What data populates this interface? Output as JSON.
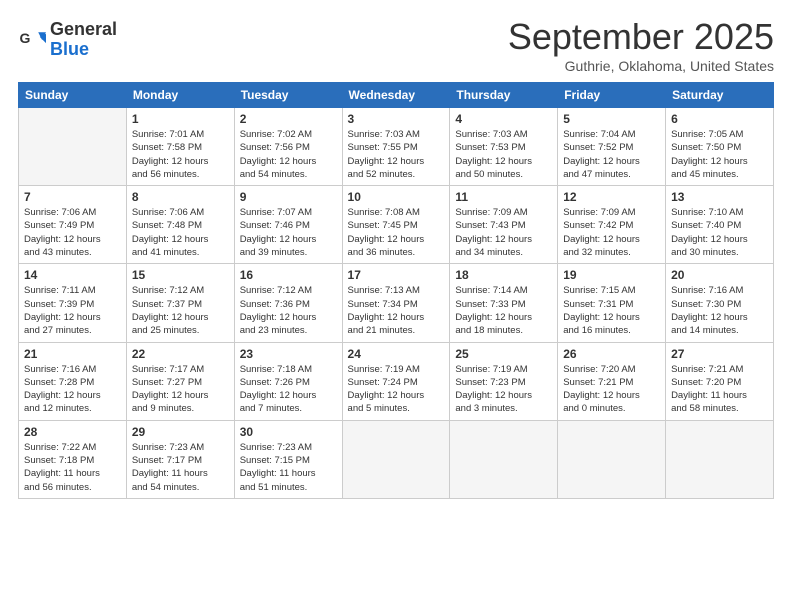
{
  "header": {
    "logo_line1": "General",
    "logo_line2": "Blue",
    "month": "September 2025",
    "location": "Guthrie, Oklahoma, United States"
  },
  "days_of_week": [
    "Sunday",
    "Monday",
    "Tuesday",
    "Wednesday",
    "Thursday",
    "Friday",
    "Saturday"
  ],
  "weeks": [
    [
      {
        "day": "",
        "info": ""
      },
      {
        "day": "1",
        "info": "Sunrise: 7:01 AM\nSunset: 7:58 PM\nDaylight: 12 hours\nand 56 minutes."
      },
      {
        "day": "2",
        "info": "Sunrise: 7:02 AM\nSunset: 7:56 PM\nDaylight: 12 hours\nand 54 minutes."
      },
      {
        "day": "3",
        "info": "Sunrise: 7:03 AM\nSunset: 7:55 PM\nDaylight: 12 hours\nand 52 minutes."
      },
      {
        "day": "4",
        "info": "Sunrise: 7:03 AM\nSunset: 7:53 PM\nDaylight: 12 hours\nand 50 minutes."
      },
      {
        "day": "5",
        "info": "Sunrise: 7:04 AM\nSunset: 7:52 PM\nDaylight: 12 hours\nand 47 minutes."
      },
      {
        "day": "6",
        "info": "Sunrise: 7:05 AM\nSunset: 7:50 PM\nDaylight: 12 hours\nand 45 minutes."
      }
    ],
    [
      {
        "day": "7",
        "info": "Sunrise: 7:06 AM\nSunset: 7:49 PM\nDaylight: 12 hours\nand 43 minutes."
      },
      {
        "day": "8",
        "info": "Sunrise: 7:06 AM\nSunset: 7:48 PM\nDaylight: 12 hours\nand 41 minutes."
      },
      {
        "day": "9",
        "info": "Sunrise: 7:07 AM\nSunset: 7:46 PM\nDaylight: 12 hours\nand 39 minutes."
      },
      {
        "day": "10",
        "info": "Sunrise: 7:08 AM\nSunset: 7:45 PM\nDaylight: 12 hours\nand 36 minutes."
      },
      {
        "day": "11",
        "info": "Sunrise: 7:09 AM\nSunset: 7:43 PM\nDaylight: 12 hours\nand 34 minutes."
      },
      {
        "day": "12",
        "info": "Sunrise: 7:09 AM\nSunset: 7:42 PM\nDaylight: 12 hours\nand 32 minutes."
      },
      {
        "day": "13",
        "info": "Sunrise: 7:10 AM\nSunset: 7:40 PM\nDaylight: 12 hours\nand 30 minutes."
      }
    ],
    [
      {
        "day": "14",
        "info": "Sunrise: 7:11 AM\nSunset: 7:39 PM\nDaylight: 12 hours\nand 27 minutes."
      },
      {
        "day": "15",
        "info": "Sunrise: 7:12 AM\nSunset: 7:37 PM\nDaylight: 12 hours\nand 25 minutes."
      },
      {
        "day": "16",
        "info": "Sunrise: 7:12 AM\nSunset: 7:36 PM\nDaylight: 12 hours\nand 23 minutes."
      },
      {
        "day": "17",
        "info": "Sunrise: 7:13 AM\nSunset: 7:34 PM\nDaylight: 12 hours\nand 21 minutes."
      },
      {
        "day": "18",
        "info": "Sunrise: 7:14 AM\nSunset: 7:33 PM\nDaylight: 12 hours\nand 18 minutes."
      },
      {
        "day": "19",
        "info": "Sunrise: 7:15 AM\nSunset: 7:31 PM\nDaylight: 12 hours\nand 16 minutes."
      },
      {
        "day": "20",
        "info": "Sunrise: 7:16 AM\nSunset: 7:30 PM\nDaylight: 12 hours\nand 14 minutes."
      }
    ],
    [
      {
        "day": "21",
        "info": "Sunrise: 7:16 AM\nSunset: 7:28 PM\nDaylight: 12 hours\nand 12 minutes."
      },
      {
        "day": "22",
        "info": "Sunrise: 7:17 AM\nSunset: 7:27 PM\nDaylight: 12 hours\nand 9 minutes."
      },
      {
        "day": "23",
        "info": "Sunrise: 7:18 AM\nSunset: 7:26 PM\nDaylight: 12 hours\nand 7 minutes."
      },
      {
        "day": "24",
        "info": "Sunrise: 7:19 AM\nSunset: 7:24 PM\nDaylight: 12 hours\nand 5 minutes."
      },
      {
        "day": "25",
        "info": "Sunrise: 7:19 AM\nSunset: 7:23 PM\nDaylight: 12 hours\nand 3 minutes."
      },
      {
        "day": "26",
        "info": "Sunrise: 7:20 AM\nSunset: 7:21 PM\nDaylight: 12 hours\nand 0 minutes."
      },
      {
        "day": "27",
        "info": "Sunrise: 7:21 AM\nSunset: 7:20 PM\nDaylight: 11 hours\nand 58 minutes."
      }
    ],
    [
      {
        "day": "28",
        "info": "Sunrise: 7:22 AM\nSunset: 7:18 PM\nDaylight: 11 hours\nand 56 minutes."
      },
      {
        "day": "29",
        "info": "Sunrise: 7:23 AM\nSunset: 7:17 PM\nDaylight: 11 hours\nand 54 minutes."
      },
      {
        "day": "30",
        "info": "Sunrise: 7:23 AM\nSunset: 7:15 PM\nDaylight: 11 hours\nand 51 minutes."
      },
      {
        "day": "",
        "info": ""
      },
      {
        "day": "",
        "info": ""
      },
      {
        "day": "",
        "info": ""
      },
      {
        "day": "",
        "info": ""
      }
    ]
  ]
}
